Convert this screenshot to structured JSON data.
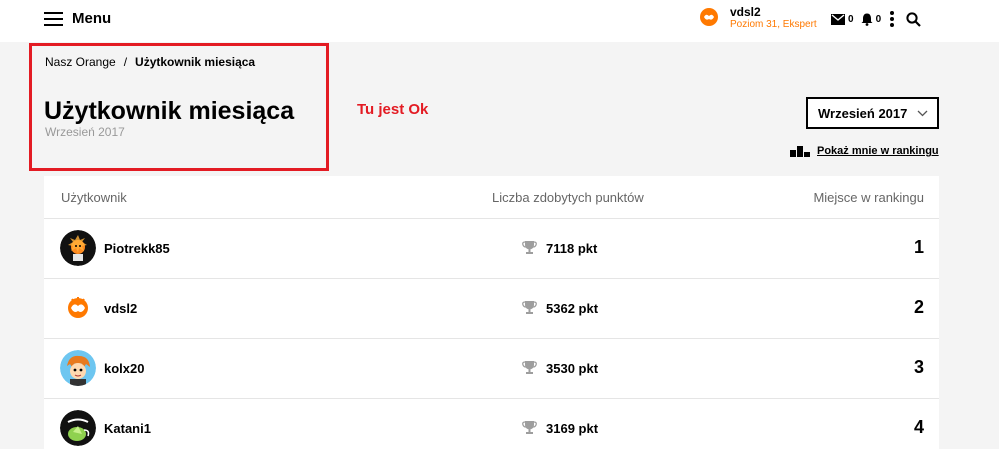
{
  "header": {
    "menu_label": "Menu",
    "user_name": "vdsl2",
    "user_level": "Poziom 31, Ekspert",
    "messages_count": "0",
    "notifications_count": "0"
  },
  "breadcrumb": {
    "home": "Nasz Orange",
    "separator": "/",
    "current": "Użytkownik miesiąca"
  },
  "page": {
    "title": "Użytkownik miesiąca",
    "subtitle": "Wrzesień 2017",
    "annotation": "Tu jest Ok",
    "month_selected": "Wrzesień 2017",
    "show_me_link": "Pokaż mnie w rankingu"
  },
  "table": {
    "columns": {
      "user": "Użytkownik",
      "points": "Liczba zdobytych punktów",
      "rank": "Miejsce w rankingu"
    },
    "rows": [
      {
        "user": "Piotrekk85",
        "points": "7118 pkt",
        "rank": "1"
      },
      {
        "user": "vdsl2",
        "points": "5362 pkt",
        "rank": "2"
      },
      {
        "user": "kolx20",
        "points": "3530 pkt",
        "rank": "3"
      },
      {
        "user": "Katani1",
        "points": "3169 pkt",
        "rank": "4"
      }
    ]
  },
  "colors": {
    "brand_orange": "#ff7900",
    "annotation_red": "#e31b23"
  },
  "icons": [
    "menu-icon",
    "mail-icon",
    "bell-icon",
    "more-icon",
    "search-icon",
    "chevron-down-icon",
    "podium-icon",
    "trophy-icon"
  ]
}
